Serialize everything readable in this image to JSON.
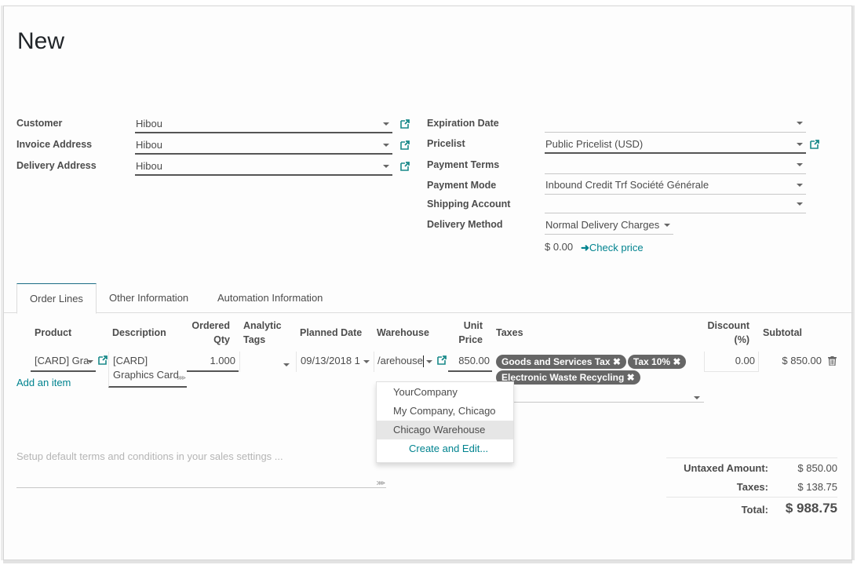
{
  "page": {
    "title": "New"
  },
  "left_fields": [
    {
      "label": "Customer",
      "value": "Hibou"
    },
    {
      "label": "Invoice Address",
      "value": "Hibou"
    },
    {
      "label": "Delivery Address",
      "value": "Hibou"
    }
  ],
  "right_fields": [
    {
      "label": "Expiration Date",
      "value": ""
    },
    {
      "label": "Pricelist",
      "value": "Public Pricelist (USD)"
    },
    {
      "label": "Payment Terms",
      "value": ""
    },
    {
      "label": "Payment Mode",
      "value": "Inbound Credit Trf Société Générale"
    },
    {
      "label": "Shipping Account",
      "value": ""
    },
    {
      "label": "Delivery Method",
      "value": "Normal Delivery Charges"
    }
  ],
  "delivery": {
    "price": "$ 0.00",
    "check_price": "Check price"
  },
  "tabs": [
    "Order Lines",
    "Other Information",
    "Automation Information"
  ],
  "table": {
    "headers": {
      "product": "Product",
      "description": "Description",
      "qty_1": "Ordered",
      "qty_2": "Qty",
      "tags_1": "Analytic",
      "tags_2": "Tags",
      "planned_date": "Planned Date",
      "warehouse": "Warehouse",
      "price_1": "Unit",
      "price_2": "Price",
      "taxes": "Taxes",
      "discount_1": "Discount",
      "discount_2": "(%)",
      "subtotal": "Subtotal"
    },
    "row": {
      "product": "[CARD] Gra",
      "description_1": "[CARD]",
      "description_2": "Graphics Card",
      "qty": "1.000",
      "analytic_tags": "",
      "planned_date": "09/13/2018 1",
      "warehouse": "/arehouse",
      "unit_price": "850.00",
      "taxes": [
        "Goods and Services Tax",
        "Tax 10%",
        "Electronic Waste Recycling"
      ],
      "discount": "0.00",
      "subtotal": "$ 850.00"
    },
    "add_item": "Add an item"
  },
  "warehouse_dropdown": {
    "options": [
      "YourCompany",
      "My Company, Chicago",
      "Chicago Warehouse"
    ],
    "highlighted": "Chicago Warehouse",
    "create": "Create and Edit..."
  },
  "terms": {
    "placeholder": "Setup default terms and conditions in your sales settings ..."
  },
  "totals": {
    "untaxed_label": "Untaxed Amount:",
    "untaxed": "$ 850.00",
    "taxes_label": "Taxes:",
    "taxes": "$ 138.75",
    "total_label": "Total:",
    "total": "$ 988.75"
  },
  "colors": {
    "accent": "#00838f",
    "tag_bg": "#666666"
  }
}
